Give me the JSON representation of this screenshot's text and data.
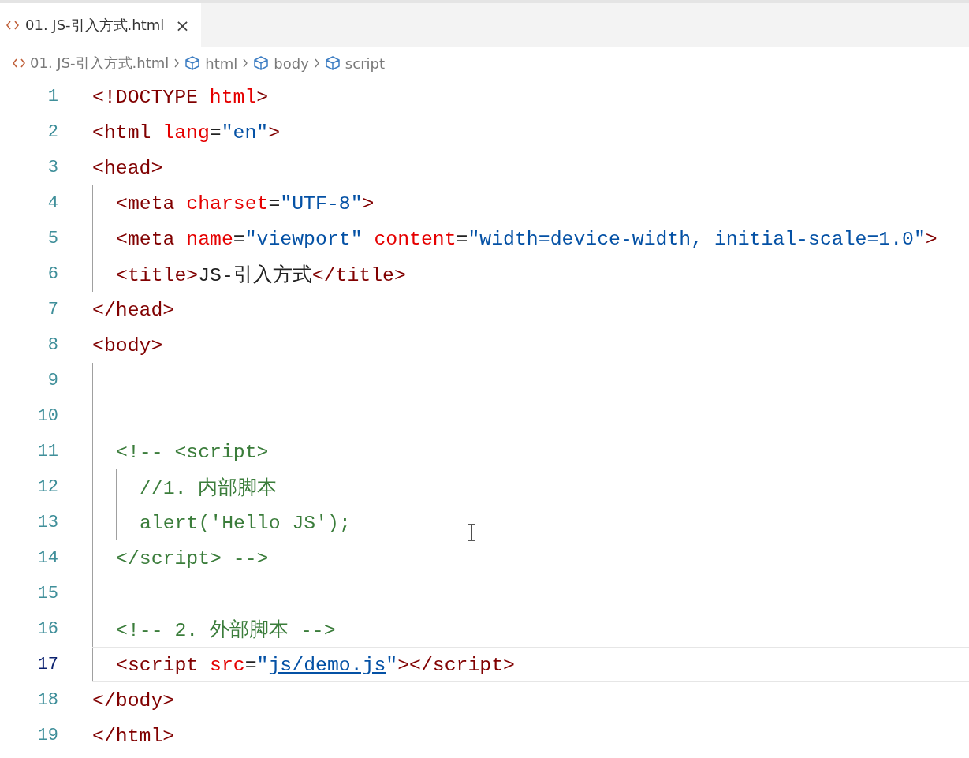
{
  "tabs": [
    {
      "label": "01. JS-引入方式.html",
      "close": "×",
      "selected": true
    }
  ],
  "breadcrumbs": [
    {
      "kind": "file",
      "label": "01. JS-引入方式.html"
    },
    {
      "kind": "element",
      "label": "html"
    },
    {
      "kind": "element",
      "label": "body"
    },
    {
      "kind": "element",
      "label": "script"
    }
  ],
  "lines": [
    {
      "number": "1",
      "current": false,
      "tokens": [
        {
          "kind": "tag",
          "text": "<!DOCTYPE "
        },
        {
          "kind": "attr",
          "text": "html"
        },
        {
          "kind": "tag",
          "text": ">"
        }
      ]
    },
    {
      "number": "2",
      "current": false,
      "tokens": [
        {
          "kind": "tag",
          "text": "<html "
        },
        {
          "kind": "attr",
          "text": "lang"
        },
        {
          "kind": "text",
          "text": "="
        },
        {
          "kind": "string",
          "text": "\"en\""
        },
        {
          "kind": "tag",
          "text": ">"
        }
      ]
    },
    {
      "number": "3",
      "current": false,
      "tokens": [
        {
          "kind": "tag",
          "text": "<head>"
        }
      ]
    },
    {
      "number": "4",
      "current": false,
      "tokens": [
        {
          "kind": "tag",
          "text": "  <meta "
        },
        {
          "kind": "attr",
          "text": "charset"
        },
        {
          "kind": "text",
          "text": "="
        },
        {
          "kind": "string",
          "text": "\"UTF-8\""
        },
        {
          "kind": "tag",
          "text": ">"
        }
      ]
    },
    {
      "number": "5",
      "current": false,
      "tokens": [
        {
          "kind": "tag",
          "text": "  <meta "
        },
        {
          "kind": "attr",
          "text": "name"
        },
        {
          "kind": "text",
          "text": "="
        },
        {
          "kind": "string",
          "text": "\"viewport\" "
        },
        {
          "kind": "attr",
          "text": "content"
        },
        {
          "kind": "text",
          "text": "="
        },
        {
          "kind": "string",
          "text": "\"width=device-width, initial-scale=1.0\""
        },
        {
          "kind": "tag",
          "text": ">"
        }
      ]
    },
    {
      "number": "6",
      "current": false,
      "tokens": [
        {
          "kind": "tag",
          "text": "  <title>"
        },
        {
          "kind": "text",
          "text": "JS-引入方式"
        },
        {
          "kind": "tag",
          "text": "</title>"
        }
      ]
    },
    {
      "number": "7",
      "current": false,
      "tokens": [
        {
          "kind": "tag",
          "text": "</head>"
        }
      ]
    },
    {
      "number": "8",
      "current": false,
      "tokens": [
        {
          "kind": "tag",
          "text": "<body>"
        }
      ]
    },
    {
      "number": "9",
      "current": false
    },
    {
      "number": "10",
      "current": false
    },
    {
      "number": "11",
      "current": false,
      "tokens": [
        {
          "kind": "comment",
          "text": "  <!-- <script>"
        }
      ]
    },
    {
      "number": "12",
      "current": false,
      "tokens": [
        {
          "kind": "comment",
          "text": "    //1. 内部脚本"
        }
      ]
    },
    {
      "number": "13",
      "current": false,
      "tokens": [
        {
          "kind": "comment",
          "text": "    alert('Hello JS');"
        }
      ]
    },
    {
      "number": "14",
      "current": false,
      "tokens": [
        {
          "kind": "comment",
          "text": "  </script> -->"
        }
      ]
    },
    {
      "number": "15",
      "current": false
    },
    {
      "number": "16",
      "current": false,
      "tokens": [
        {
          "kind": "comment",
          "text": "  <!-- 2. 外部脚本 -->"
        }
      ]
    },
    {
      "number": "17",
      "current": true,
      "tokens": [
        {
          "kind": "tag",
          "text": "  <script "
        },
        {
          "kind": "attr",
          "text": "src"
        },
        {
          "kind": "text",
          "text": "="
        },
        {
          "kind": "string",
          "text": "\""
        },
        {
          "kind": "link",
          "text": "js/demo.js"
        },
        {
          "kind": "string",
          "text": "\""
        },
        {
          "kind": "tag",
          "text": "></script>"
        }
      ]
    },
    {
      "number": "18",
      "current": false,
      "tokens": [
        {
          "kind": "tag",
          "text": "</body>"
        }
      ]
    },
    {
      "number": "19",
      "current": false,
      "tokens": [
        {
          "kind": "tag",
          "text": "</html>"
        }
      ]
    }
  ]
}
